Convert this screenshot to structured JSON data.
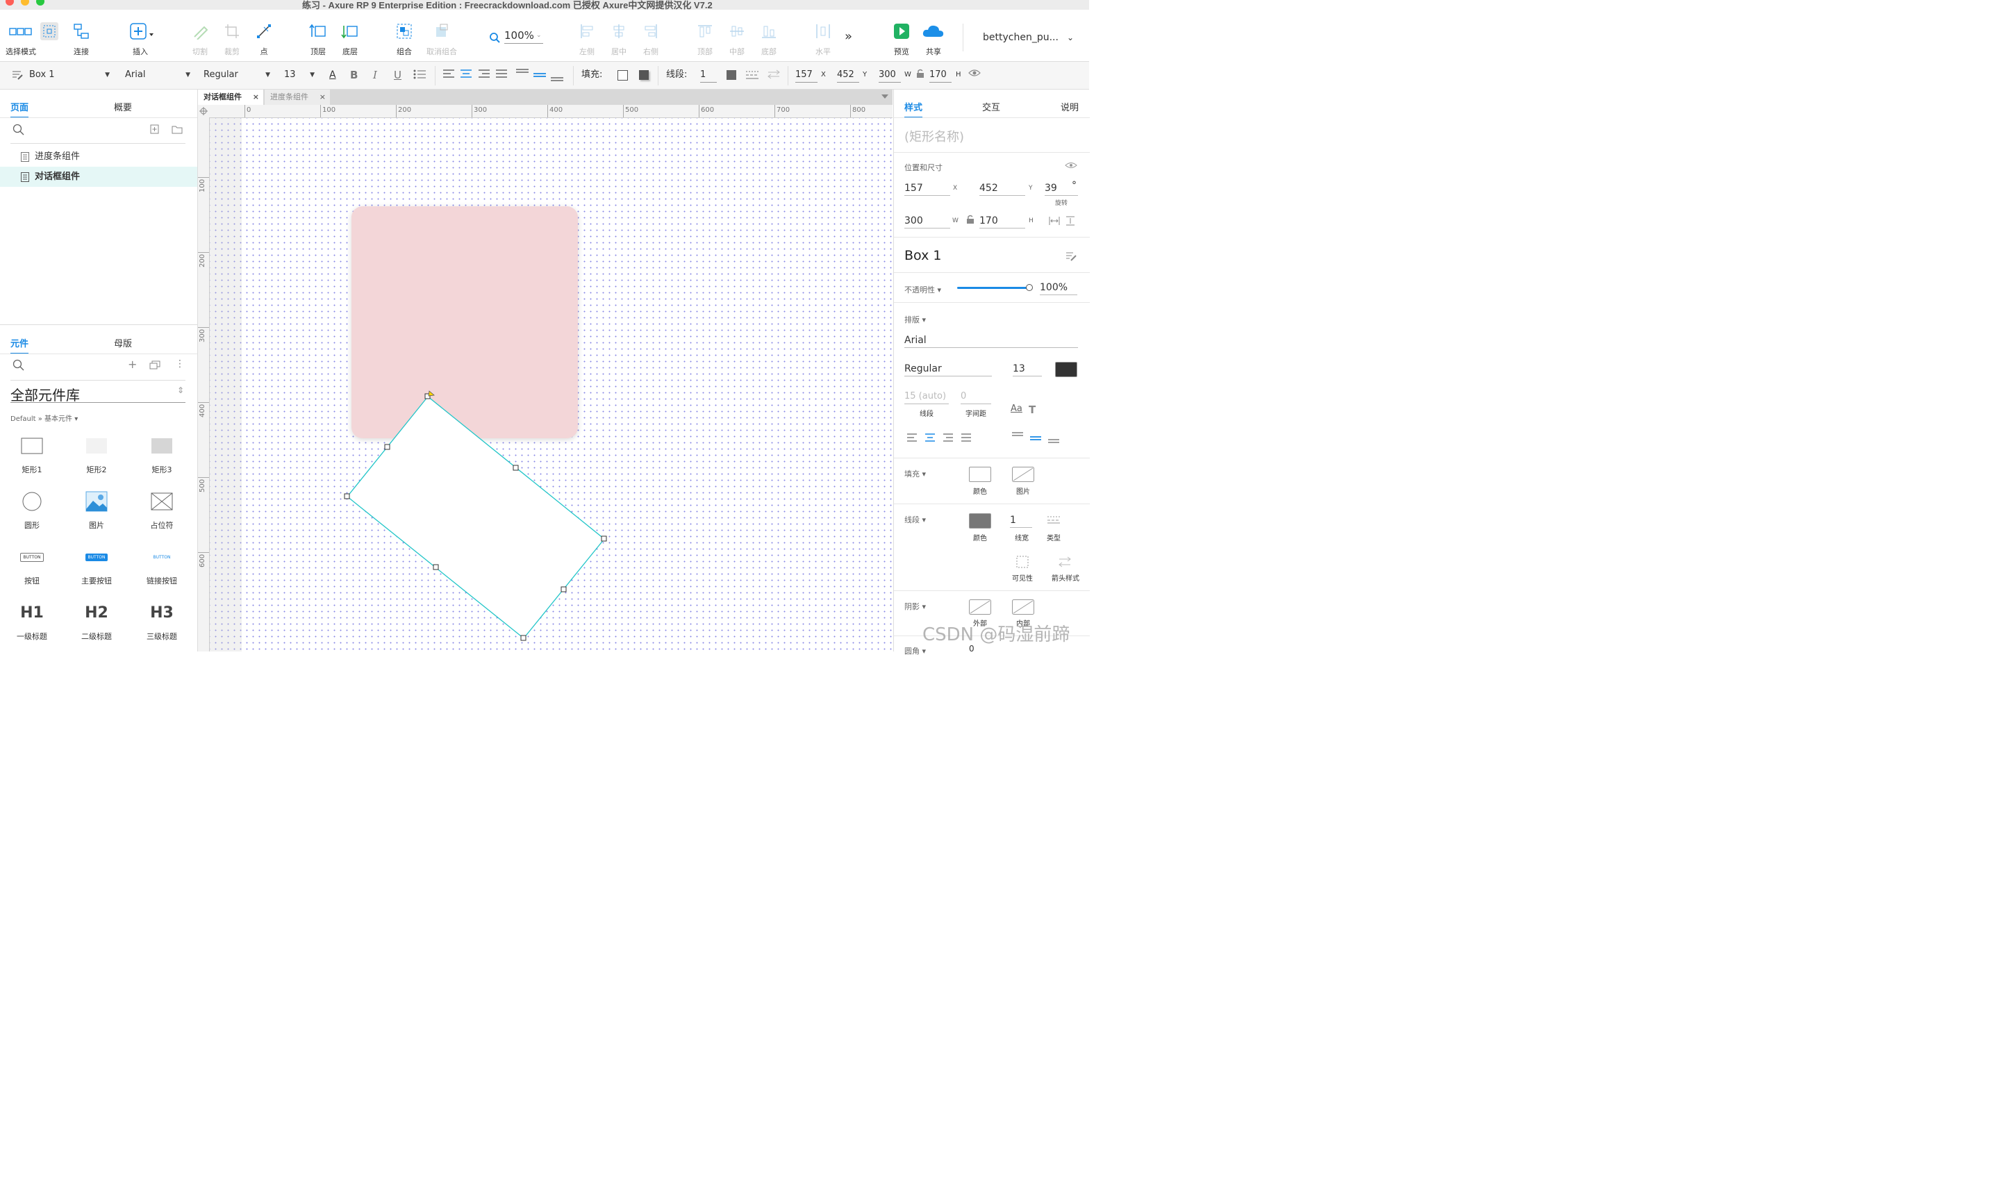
{
  "window": {
    "title": "练习 - Axure RP 9 Enterprise Edition : Freecrackdownload.com 已授权     Axure中文网提供汉化 V7.2"
  },
  "toolbar": {
    "select_mode": "选择模式",
    "connect": "连接",
    "insert": "插入",
    "cut": "切割",
    "crop": "裁剪",
    "point": "点",
    "top_layer": "顶层",
    "bottom_layer": "底层",
    "group": "组合",
    "ungroup": "取消组合",
    "zoom": "100%",
    "align_left": "左侧",
    "align_center": "居中",
    "align_right": "右侧",
    "align_top": "顶部",
    "align_middle": "中部",
    "align_bottom": "底部",
    "distribute_h": "水平",
    "more": "»",
    "preview": "预览",
    "share": "共享",
    "user": "bettychen_pu..."
  },
  "format": {
    "widget_name": "Box 1",
    "font": "Arial",
    "style": "Regular",
    "size": "13",
    "fill_label": "填充:",
    "stroke_label": "线段:",
    "stroke_width": "1",
    "x": "157",
    "y": "452",
    "w": "300",
    "h": "170",
    "x_label": "X",
    "y_label": "Y",
    "w_label": "W",
    "h_label": "H"
  },
  "left": {
    "tab_pages": "页面",
    "tab_outline": "概要",
    "pages": [
      "进度条组件",
      "对话框组件"
    ],
    "tab_widgets": "元件",
    "tab_masters": "母版",
    "library": "全部元件库",
    "breadcrumb": "Default » 基本元件 ▾",
    "widgets": [
      {
        "label": "矩形1",
        "icon": "rect1-icon"
      },
      {
        "label": "矩形2",
        "icon": "rect2-icon"
      },
      {
        "label": "矩形3",
        "icon": "rect3-icon"
      },
      {
        "label": "圆形",
        "icon": "circle-icon"
      },
      {
        "label": "图片",
        "icon": "image-icon"
      },
      {
        "label": "占位符",
        "icon": "placeholder-icon"
      },
      {
        "label": "按钮",
        "icon": "button-icon",
        "text": "BUTTON"
      },
      {
        "label": "主要按钮",
        "icon": "primary-button-icon",
        "text": "BUTTON"
      },
      {
        "label": "链接按钮",
        "icon": "link-button-icon",
        "text": "BUTTON"
      },
      {
        "label": "一级标题",
        "icon": "h1-icon",
        "text": "H1"
      },
      {
        "label": "二级标题",
        "icon": "h2-icon",
        "text": "H2"
      },
      {
        "label": "三级标题",
        "icon": "h3-icon",
        "text": "H3"
      }
    ]
  },
  "canvas": {
    "tabs": [
      "对话框组件",
      "进度条组件"
    ],
    "ruler_h": [
      "0",
      "100",
      "200",
      "300",
      "400",
      "500",
      "600",
      "700",
      "800"
    ],
    "ruler_v": [
      "100",
      "200",
      "300",
      "400",
      "500",
      "600"
    ],
    "colors": {
      "pink_box": "#f3d6d8",
      "selection": "#21c5c8",
      "grid": "#8a8ae6"
    },
    "rotation_deg": 39
  },
  "right": {
    "tab_style": "样式",
    "tab_interaction": "交互",
    "tab_notes": "说明",
    "shape_name_placeholder": "(矩形名称)",
    "pos_size_label": "位置和尺寸",
    "x": "157",
    "y": "452",
    "rotation": "39",
    "rotation_unit": "°",
    "rotation_label": "旋转",
    "w": "300",
    "h": "170",
    "x_label": "X",
    "y_label": "Y",
    "w_label": "W",
    "h_label": "H",
    "widget_name": "Box 1",
    "opacity_label": "不透明性 ▾",
    "opacity": "100%",
    "opacity_fraction": 1.0,
    "typography_label": "排版 ▾",
    "font": "Arial",
    "style": "Regular",
    "size": "13",
    "line_spacing": "15 (auto)",
    "line_spacing_label": "线段",
    "char_spacing": "0",
    "char_spacing_label": "字间距",
    "fill_label": "填充 ▾",
    "fill_color": "颜色",
    "fill_image": "图片",
    "stroke_label": "线段 ▾",
    "stroke_color": "颜色",
    "stroke_width": "1",
    "stroke_width_label": "线宽",
    "stroke_type": "类型",
    "visibility": "可见性",
    "arrow_style": "箭头样式",
    "shadow_label": "阴影 ▾",
    "shadow_outer": "外部",
    "shadow_inner": "内部",
    "corner_label": "圆角 ▾",
    "corner_value": "0"
  },
  "watermark": "CSDN @码湿前蹄"
}
